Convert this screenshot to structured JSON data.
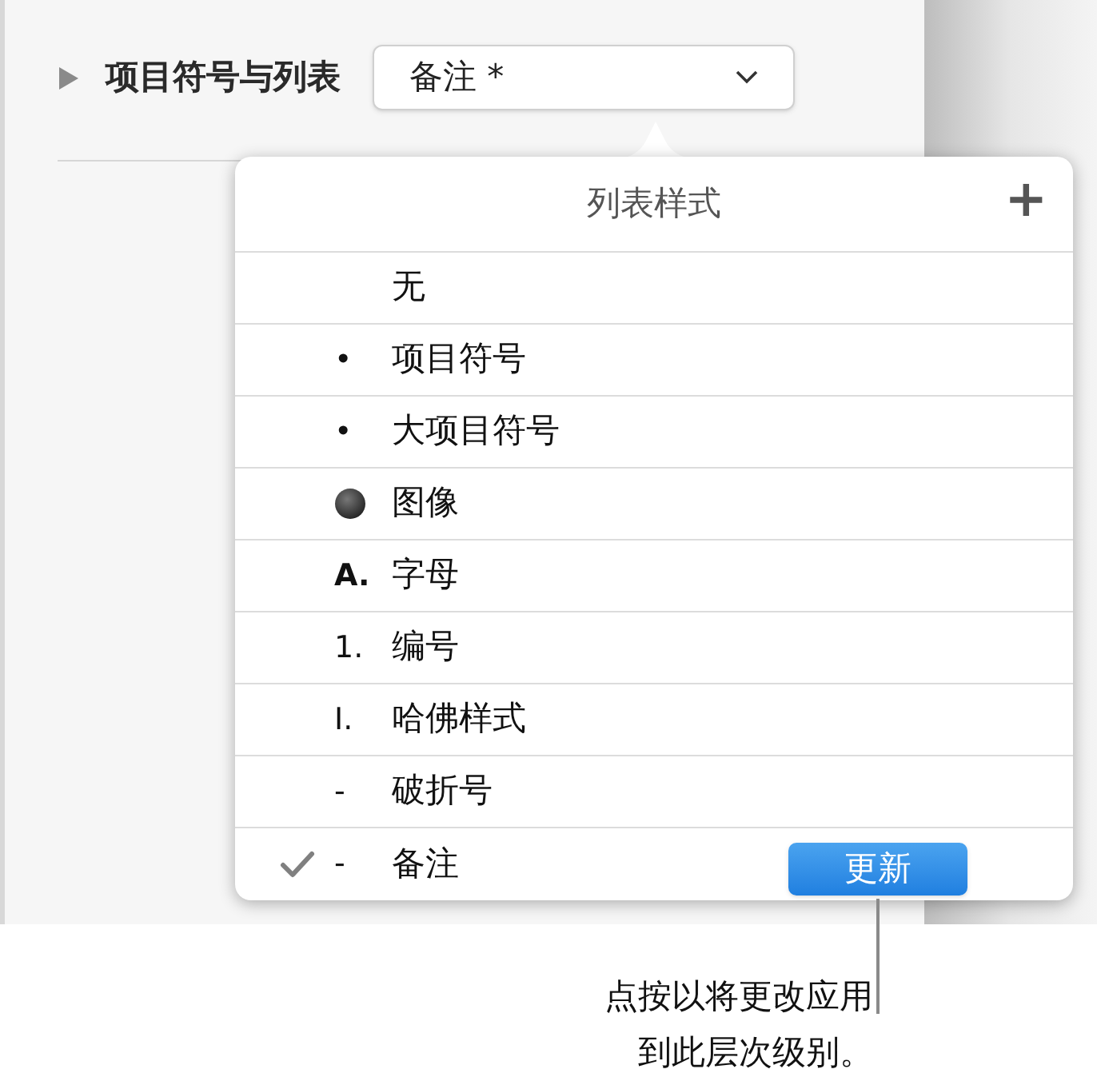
{
  "section": {
    "title": "项目符号与列表",
    "expanded": false,
    "popup_value": "备注 *"
  },
  "popover": {
    "title": "列表样式",
    "add_button": "+",
    "items": [
      {
        "kind": "none",
        "label": "无",
        "selected": false
      },
      {
        "kind": "text",
        "marker": "•",
        "label": "项目符号",
        "selected": false
      },
      {
        "kind": "text",
        "marker": "•",
        "label": "大项目符号",
        "selected": false
      },
      {
        "kind": "image",
        "label": "图像",
        "selected": false
      },
      {
        "kind": "text",
        "marker": "A.",
        "bold_marker": true,
        "label": "字母",
        "selected": false
      },
      {
        "kind": "text",
        "marker": "1.",
        "label": "编号",
        "selected": false
      },
      {
        "kind": "text",
        "marker": "I.",
        "label": "哈佛样式",
        "selected": false
      },
      {
        "kind": "text",
        "marker": "-",
        "label": "破折号",
        "selected": false
      },
      {
        "kind": "text",
        "marker": "-",
        "label": "备注",
        "selected": true,
        "action": "更新"
      }
    ]
  },
  "callout": [
    "点按以将更改应用",
    "到此层次级别。"
  ]
}
